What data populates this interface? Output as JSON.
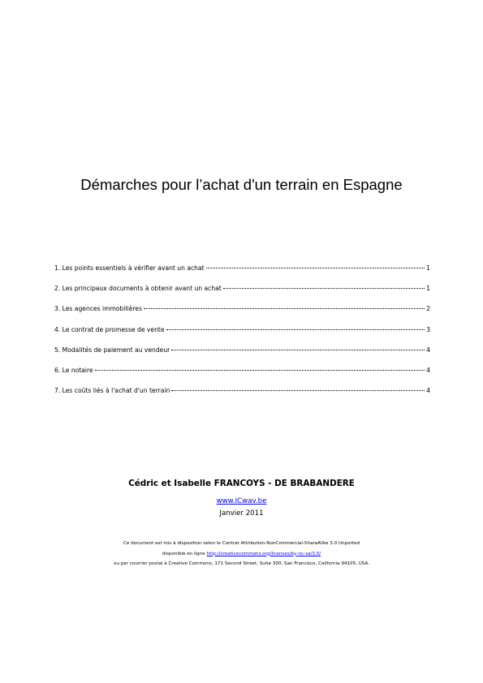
{
  "document": {
    "title": "Démarches pour l’achat d'un terrain en Espagne",
    "toc": [
      {
        "label": "1. Les points essentiels à vérifier avant un achat",
        "page": "1"
      },
      {
        "label": "2. Les principaux documents à obtenir avant un achat",
        "page": "1"
      },
      {
        "label": "3. Les agences immobilières",
        "page": "2"
      },
      {
        "label": "4. Le contrat de promesse de vente",
        "page": "3"
      },
      {
        "label": "5. Modalités de paiement au vendeur",
        "page": "4"
      },
      {
        "label": "6. Le notaire",
        "page": "4"
      },
      {
        "label": "7. Les coûts liés à l'achat d'un terrain",
        "page": "4"
      }
    ],
    "authors": "Cédric et Isabelle FRANCOYS - DE BRABANDERE",
    "website": "www.ICwav.be",
    "date": "Janvier 2011",
    "license": {
      "line1": "Ce document est mis à disposition selon le Contrat Attribution-NonCommercial-ShareAlike 3.0 Unported",
      "line2_prefix": "disponible en ligne ",
      "line2_link": "http://creativecommons.org/licenses/by-nc-sa/3.0/",
      "line3": "ou par courrier postal à Creative Commons, 171 Second Street, Suite 300, San Francisco, California 94105, USA."
    }
  },
  "colors": {
    "text": "#000000",
    "link": "#0000ee",
    "background": "#ffffff"
  }
}
